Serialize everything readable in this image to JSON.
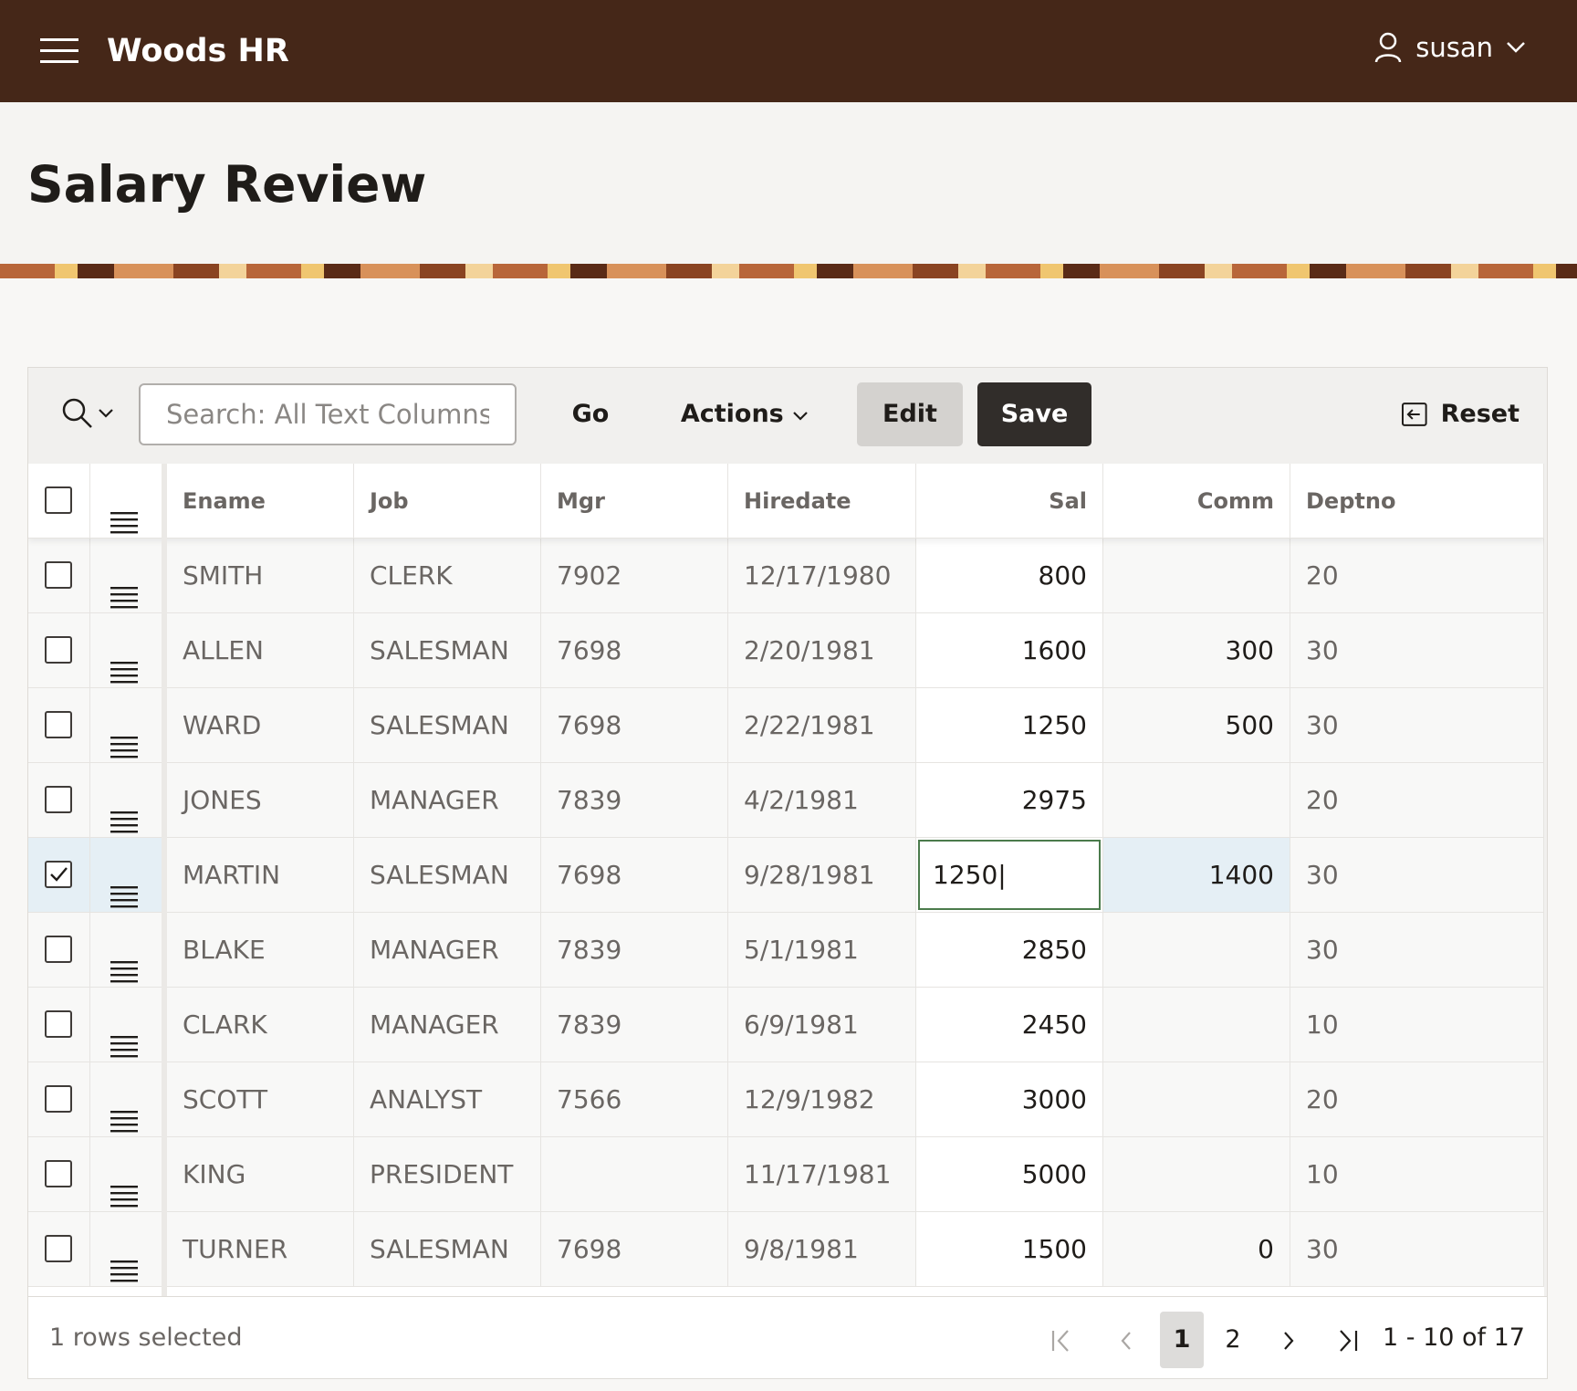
{
  "app": {
    "title": "Woods HR",
    "user": "susan"
  },
  "page": {
    "title": "Salary Review"
  },
  "toolbar": {
    "search_placeholder": "Search: All Text Columns",
    "go_label": "Go",
    "actions_label": "Actions",
    "edit_label": "Edit",
    "save_label": "Save",
    "reset_label": "Reset"
  },
  "grid": {
    "columns": [
      "Ename",
      "Job",
      "Mgr",
      "Hiredate",
      "Sal",
      "Comm",
      "Deptno"
    ],
    "rows": [
      {
        "ename": "SMITH",
        "job": "CLERK",
        "mgr": "7902",
        "hiredate": "12/17/1980",
        "sal": "800",
        "comm": "",
        "deptno": "20",
        "selected": false
      },
      {
        "ename": "ALLEN",
        "job": "SALESMAN",
        "mgr": "7698",
        "hiredate": "2/20/1981",
        "sal": "1600",
        "comm": "300",
        "deptno": "30",
        "selected": false
      },
      {
        "ename": "WARD",
        "job": "SALESMAN",
        "mgr": "7698",
        "hiredate": "2/22/1981",
        "sal": "1250",
        "comm": "500",
        "deptno": "30",
        "selected": false
      },
      {
        "ename": "JONES",
        "job": "MANAGER",
        "mgr": "7839",
        "hiredate": "4/2/1981",
        "sal": "2975",
        "comm": "",
        "deptno": "20",
        "selected": false
      },
      {
        "ename": "MARTIN",
        "job": "SALESMAN",
        "mgr": "7698",
        "hiredate": "9/28/1981",
        "sal": "1250",
        "comm": "1400",
        "deptno": "30",
        "selected": true,
        "editing": true
      },
      {
        "ename": "BLAKE",
        "job": "MANAGER",
        "mgr": "7839",
        "hiredate": "5/1/1981",
        "sal": "2850",
        "comm": "",
        "deptno": "30",
        "selected": false
      },
      {
        "ename": "CLARK",
        "job": "MANAGER",
        "mgr": "7839",
        "hiredate": "6/9/1981",
        "sal": "2450",
        "comm": "",
        "deptno": "10",
        "selected": false
      },
      {
        "ename": "SCOTT",
        "job": "ANALYST",
        "mgr": "7566",
        "hiredate": "12/9/1982",
        "sal": "3000",
        "comm": "",
        "deptno": "20",
        "selected": false
      },
      {
        "ename": "KING",
        "job": "PRESIDENT",
        "mgr": "",
        "hiredate": "11/17/1981",
        "sal": "5000",
        "comm": "",
        "deptno": "10",
        "selected": false
      },
      {
        "ename": "TURNER",
        "job": "SALESMAN",
        "mgr": "7698",
        "hiredate": "9/8/1981",
        "sal": "1500",
        "comm": "0",
        "deptno": "30",
        "selected": false
      }
    ]
  },
  "footer": {
    "selection_text": "1 rows selected",
    "pages": [
      "1",
      "2"
    ],
    "current_page": "1",
    "range_text": "1 - 10 of 17"
  },
  "colors": {
    "header_bg": "#452718",
    "save_bg": "#312d2a",
    "selected_row": "#e5eff5",
    "edit_border": "#4b7b4c"
  },
  "icons": [
    "hamburger-icon",
    "user-icon",
    "chevron-down-icon",
    "search-icon",
    "reset-icon",
    "row-menu-icon",
    "first-page-icon",
    "prev-page-icon",
    "next-page-icon",
    "last-page-icon"
  ]
}
